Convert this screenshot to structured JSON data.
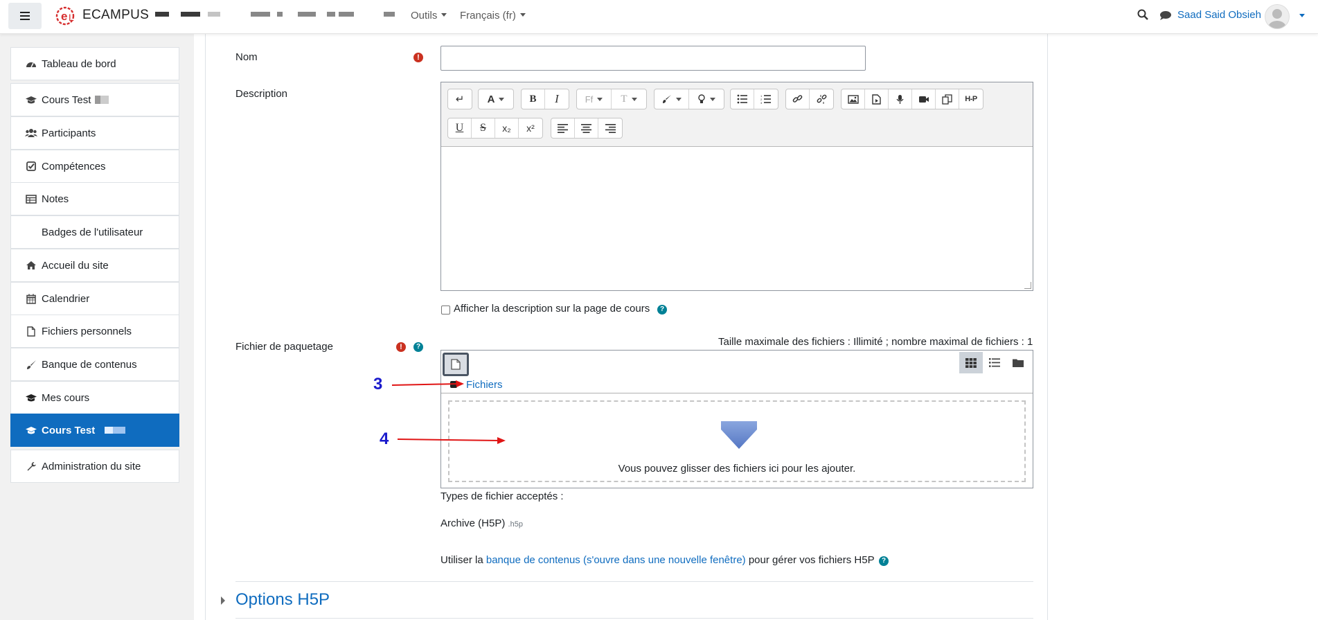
{
  "header": {
    "logo_text": "ECAMPUS",
    "menus": [
      {
        "label": "Outils"
      },
      {
        "label": "Français (fr)"
      }
    ],
    "user_name": "Saad Said Obsieh"
  },
  "sidebar": {
    "items": [
      {
        "label": "Tableau de bord",
        "icon": "dashboard-icon"
      },
      {
        "label": "Cours Test",
        "icon": "graduation-cap-icon"
      },
      {
        "label": "Participants",
        "icon": "users-icon"
      },
      {
        "label": "Compétences",
        "icon": "checkbox-icon"
      },
      {
        "label": "Notes",
        "icon": "table-icon"
      },
      {
        "label": "Badges de l'utilisateur",
        "icon": ""
      },
      {
        "label": "Accueil du site",
        "icon": "home-icon"
      },
      {
        "label": "Calendrier",
        "icon": "calendar-icon"
      },
      {
        "label": "Fichiers personnels",
        "icon": "file-icon"
      },
      {
        "label": "Banque de contenus",
        "icon": "brush-icon"
      },
      {
        "label": "Mes cours",
        "icon": "graduation-cap-icon"
      },
      {
        "label": "Cours Test",
        "icon": "graduation-cap-icon",
        "active": true
      },
      {
        "label": "Administration du site",
        "icon": "wrench-icon"
      }
    ]
  },
  "form": {
    "name_label": "Nom",
    "name_value": "",
    "description_label": "Description",
    "show_description_label": "Afficher la description sur la page de cours",
    "show_description_checked": false,
    "package_label": "Fichier de paquetage",
    "file_limits": "Taille maximale des fichiers : Illimité ; nombre maximal de fichiers : 1",
    "path_label": "Fichiers",
    "drop_text": "Vous pouvez glisser des fichiers ici pour les ajouter.",
    "accepted_types_label": "Types de fichier acceptés :",
    "accepted_type_name": "Archive (H5P)",
    "accepted_type_ext": ".h5p",
    "bank_text_before": "Utiliser la",
    "bank_link": "banque de contenus (s'ouvre dans une nouvelle fenêtre)",
    "bank_text_after": "pour gérer vos fichiers H5P",
    "section_options": "Options H5P"
  },
  "editor_toolbar": {
    "row1": [
      "↵",
      "A",
      "B",
      "I",
      "Ff",
      "T",
      "brush",
      "bulb",
      "ul",
      "ol",
      "link",
      "unlink",
      "image",
      "media",
      "mic",
      "video",
      "copy",
      "H-P"
    ],
    "row2": [
      "U",
      "S",
      "x₂",
      "x²",
      "align-left",
      "align-center",
      "align-right"
    ]
  },
  "annotations": {
    "marker_3": "3",
    "marker_4": "4"
  },
  "colors": {
    "brand": "#0f6cbf",
    "required": "#ca3120",
    "help": "#008196",
    "annotation": "#1a1acc",
    "arrow": "#e01515"
  }
}
